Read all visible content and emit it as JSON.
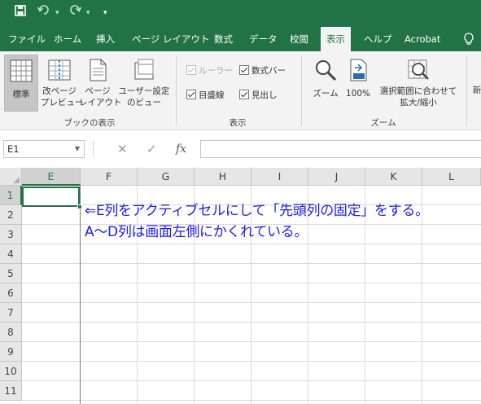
{
  "quick_access": {
    "save_icon": "save-icon",
    "undo_icon": "undo-icon",
    "redo_icon": "redo-icon",
    "customize": "▾"
  },
  "tabs": [
    "ファイル",
    "ホーム",
    "挿入",
    "ページ レイアウト",
    "数式",
    "データ",
    "校閲",
    "表示",
    "ヘルプ",
    "Acrobat"
  ],
  "active_tab": "表示",
  "ribbon": {
    "book_views": {
      "group_label": "ブックの表示",
      "normal": "標準",
      "page_break_1": "改ページ",
      "page_break_2": "プレビュー",
      "page_layout_1": "ページ",
      "page_layout_2": "レイアウト",
      "custom_1": "ユーザー設定",
      "custom_2": "のビュー"
    },
    "show": {
      "group_label": "表示",
      "ruler": "ルーラー",
      "formula_bar": "数式バー",
      "gridlines": "目盛線",
      "headings": "見出し"
    },
    "zoom": {
      "group_label": "ズーム",
      "zoom": "ズーム",
      "hundred": "100%",
      "selection_1": "選択範囲に合わせて",
      "selection_2": "拡大/縮小",
      "hundred_icon_text": "100"
    },
    "cut_off": "新"
  },
  "formula_bar": {
    "name_box": "E1",
    "cancel": "✕",
    "enter": "✓",
    "fx": "fx",
    "value": ""
  },
  "grid": {
    "columns": [
      "E",
      "F",
      "G",
      "H",
      "I",
      "J",
      "K",
      "L"
    ],
    "rows": [
      "1",
      "2",
      "3",
      "4",
      "5",
      "6",
      "7",
      "8",
      "9",
      "10",
      "11"
    ],
    "selected_column": "E",
    "selected_row": "1"
  },
  "note": {
    "line1": "⇐E列をアクティブセルにして「先頭列の固定」をする。",
    "line2": "A～D列は画面左側にかくれている。"
  },
  "colors": {
    "accent": "#217346",
    "note": "#1a1aff"
  }
}
